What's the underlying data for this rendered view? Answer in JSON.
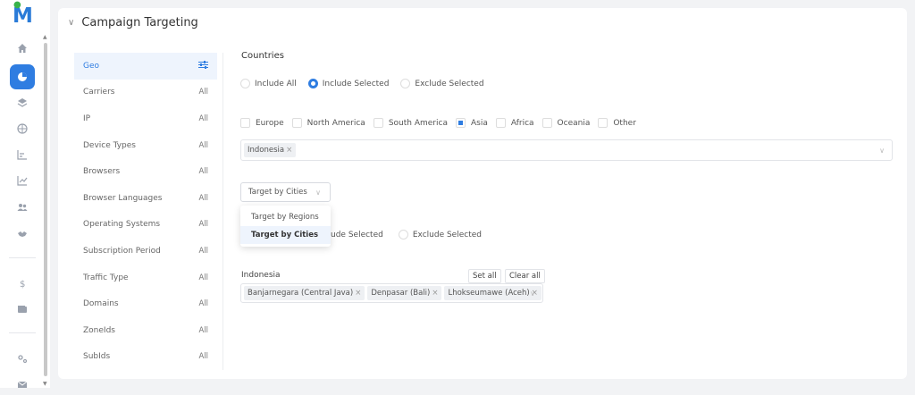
{
  "app": {
    "logo_text": "M"
  },
  "sidebar": {
    "icons": [
      "home-icon",
      "pie-chart-icon",
      "layers-icon",
      "globe-icon",
      "bar-list-icon",
      "line-chart-icon",
      "users-icon",
      "handshake-icon",
      "dollar-icon",
      "wallet-icon",
      "settings-icon",
      "mail-icon"
    ]
  },
  "panel": {
    "title": "Campaign Targeting"
  },
  "menu": {
    "items": [
      {
        "label": "Geo",
        "value": ""
      },
      {
        "label": "Carriers",
        "value": "All"
      },
      {
        "label": "IP",
        "value": "All"
      },
      {
        "label": "Device Types",
        "value": "All"
      },
      {
        "label": "Browsers",
        "value": "All"
      },
      {
        "label": "Browser Languages",
        "value": "All"
      },
      {
        "label": "Operating Systems",
        "value": "All"
      },
      {
        "label": "Subscription Period",
        "value": "All"
      },
      {
        "label": "Traffic Type",
        "value": "All"
      },
      {
        "label": "Domains",
        "value": "All"
      },
      {
        "label": "ZoneIds",
        "value": "All"
      },
      {
        "label": "SubIds",
        "value": "All"
      }
    ],
    "active_index": 0
  },
  "countries": {
    "title": "Countries",
    "mode_options": [
      "Include All",
      "Include Selected",
      "Exclude Selected"
    ],
    "mode_selected": "Include Selected",
    "regions": [
      {
        "label": "Europe",
        "checked": false
      },
      {
        "label": "North America",
        "checked": false
      },
      {
        "label": "South America",
        "checked": false
      },
      {
        "label": "Asia",
        "checked": true
      },
      {
        "label": "Africa",
        "checked": false
      },
      {
        "label": "Oceania",
        "checked": false
      },
      {
        "label": "Other",
        "checked": false
      }
    ],
    "selected_tags": [
      "Indonesia"
    ]
  },
  "target_select": {
    "value": "Target by Cities",
    "options": [
      "Target by Regions",
      "Target by Cities"
    ],
    "highlighted": "Target by Cities"
  },
  "cities": {
    "mode_visible": [
      "ude Selected",
      "Exclude Selected"
    ],
    "country_label": "Indonesia",
    "set_all_label": "Set all",
    "clear_all_label": "Clear all",
    "selected_tags": [
      "Banjarnegara (Central Java)",
      "Denpasar (Bali)",
      "Lhokseumawe (Aceh)"
    ]
  },
  "tag_remove_symbol": "×",
  "colors": {
    "accent": "#2f7de1",
    "logo_green": "#38b24a"
  }
}
